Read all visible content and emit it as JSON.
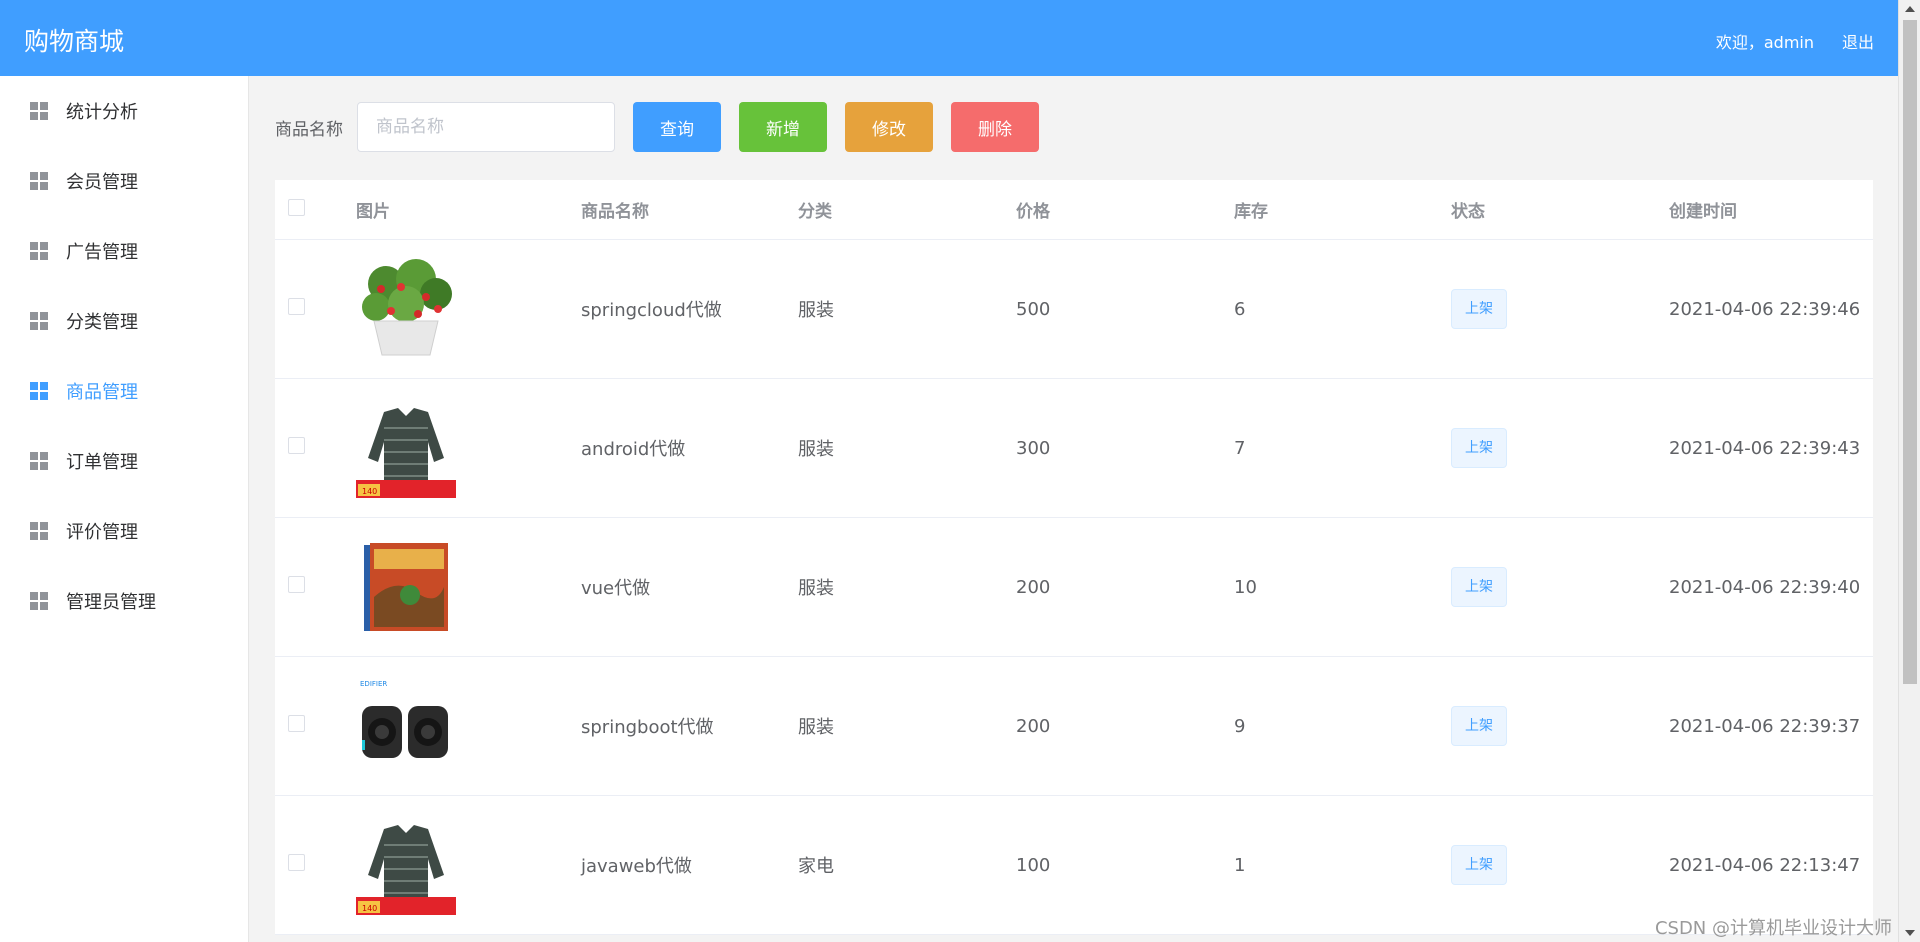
{
  "header": {
    "brand": "购物商城",
    "welcome": "欢迎，admin",
    "logout": "退出"
  },
  "sidebar": {
    "active_color": "#409eff",
    "items": [
      {
        "label": "统计分析",
        "icon": "grid-icon"
      },
      {
        "label": "会员管理",
        "icon": "grid-icon"
      },
      {
        "label": "广告管理",
        "icon": "grid-icon"
      },
      {
        "label": "分类管理",
        "icon": "grid-icon"
      },
      {
        "label": "商品管理",
        "icon": "grid-icon",
        "active": true
      },
      {
        "label": "订单管理",
        "icon": "grid-icon"
      },
      {
        "label": "评价管理",
        "icon": "grid-icon"
      },
      {
        "label": "管理员管理",
        "icon": "grid-icon"
      }
    ]
  },
  "toolbar": {
    "search_label": "商品名称",
    "search_placeholder": "商品名称",
    "query": "查询",
    "add": "新增",
    "edit": "修改",
    "delete": "删除"
  },
  "table": {
    "columns": [
      "图片",
      "商品名称",
      "分类",
      "价格",
      "库存",
      "状态",
      "创建时间"
    ],
    "rows": [
      {
        "image": "strawberry-plant-image",
        "name": "springcloud代做",
        "category": "服装",
        "price": "500",
        "stock": "6",
        "status": "上架",
        "created": "2021-04-06 22:39:46"
      },
      {
        "image": "striped-sweater-image",
        "name": "android代做",
        "category": "服装",
        "price": "300",
        "stock": "7",
        "status": "上架",
        "created": "2021-04-06 22:39:43"
      },
      {
        "image": "geography-book-image",
        "name": "vue代做",
        "category": "服装",
        "price": "200",
        "stock": "10",
        "status": "上架",
        "created": "2021-04-06 22:39:40"
      },
      {
        "image": "speakers-image",
        "name": "springboot代做",
        "category": "服装",
        "price": "200",
        "stock": "9",
        "status": "上架",
        "created": "2021-04-06 22:39:37"
      },
      {
        "image": "striped-sweater-image",
        "name": "javaweb代做",
        "category": "家电",
        "price": "100",
        "stock": "1",
        "status": "上架",
        "created": "2021-04-06 22:13:47"
      }
    ]
  },
  "watermark": "CSDN @计算机毕业设计大师"
}
